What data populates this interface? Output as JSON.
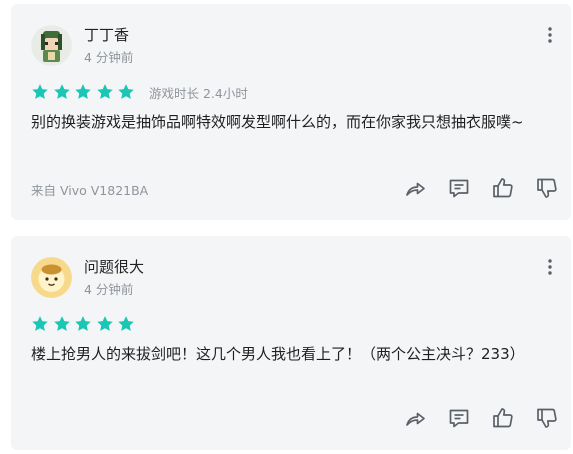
{
  "comments": [
    {
      "username": "丁丁香",
      "time": "4 分钟前",
      "stars": 5,
      "playtime": "游戏时长 2.4小时",
      "content": "别的换装游戏是抽饰品啊特效啊发型啊什么的，而在你家我只想抽衣服噗~",
      "device": "来自 Vivo V1821BA"
    },
    {
      "username": "问题很大",
      "time": "4 分钟前",
      "stars": 5,
      "content": "楼上抢男人的来拔剑吧！这几个男人我也看上了！（两个公主决斗？233）"
    }
  ],
  "colors": {
    "star": "#1bc7b4",
    "card_bg": "#f4f5f6",
    "meta_text": "#8f959c",
    "icon": "#5b6068"
  },
  "icons": [
    "more-vertical-icon",
    "share-icon",
    "comment-icon",
    "like-icon",
    "dislike-icon"
  ]
}
